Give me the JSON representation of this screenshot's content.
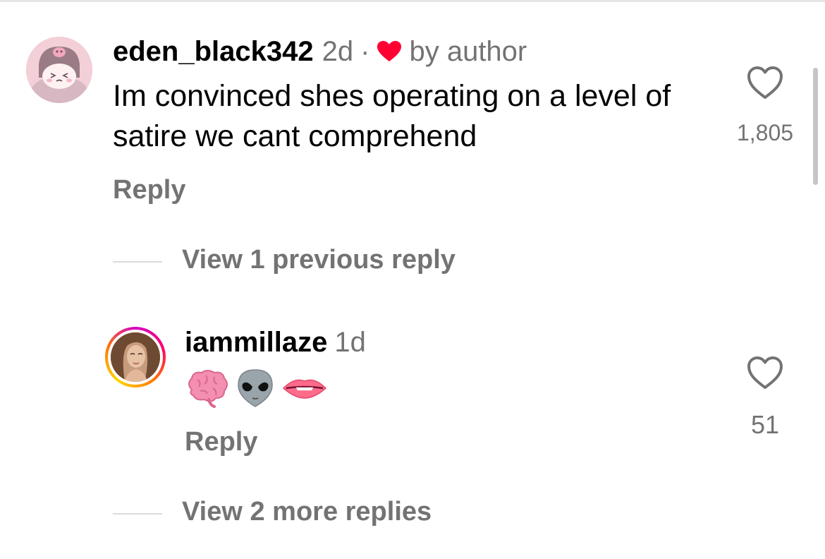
{
  "comments": [
    {
      "username": "eden_black342",
      "time": "2d",
      "separator": "·",
      "liked_by_author_icon": "heart-filled-icon",
      "liked_by_author_label": "by author",
      "text": "Im convinced shes operating on a level of satire we cant comprehend",
      "reply_label": "Reply",
      "like_icon": "heart-outline-icon",
      "like_count": "1,805",
      "avatar_icon": "cartoon-avatar-icon"
    },
    {
      "username": "iammillaze",
      "time": "1d",
      "emojis": [
        "brain-emoji",
        "alien-emoji",
        "biting-lip-emoji"
      ],
      "reply_label": "Reply",
      "like_icon": "heart-outline-icon",
      "like_count": "51",
      "avatar_icon": "profile-photo-avatar",
      "story_ring": true
    }
  ],
  "threads": {
    "view_previous": "View 1 previous reply",
    "view_more": "View 2 more replies"
  },
  "colors": {
    "text_primary": "#000000",
    "text_secondary": "#737373",
    "heart_red": "#ff3040",
    "divider": "#dbdbdb"
  }
}
